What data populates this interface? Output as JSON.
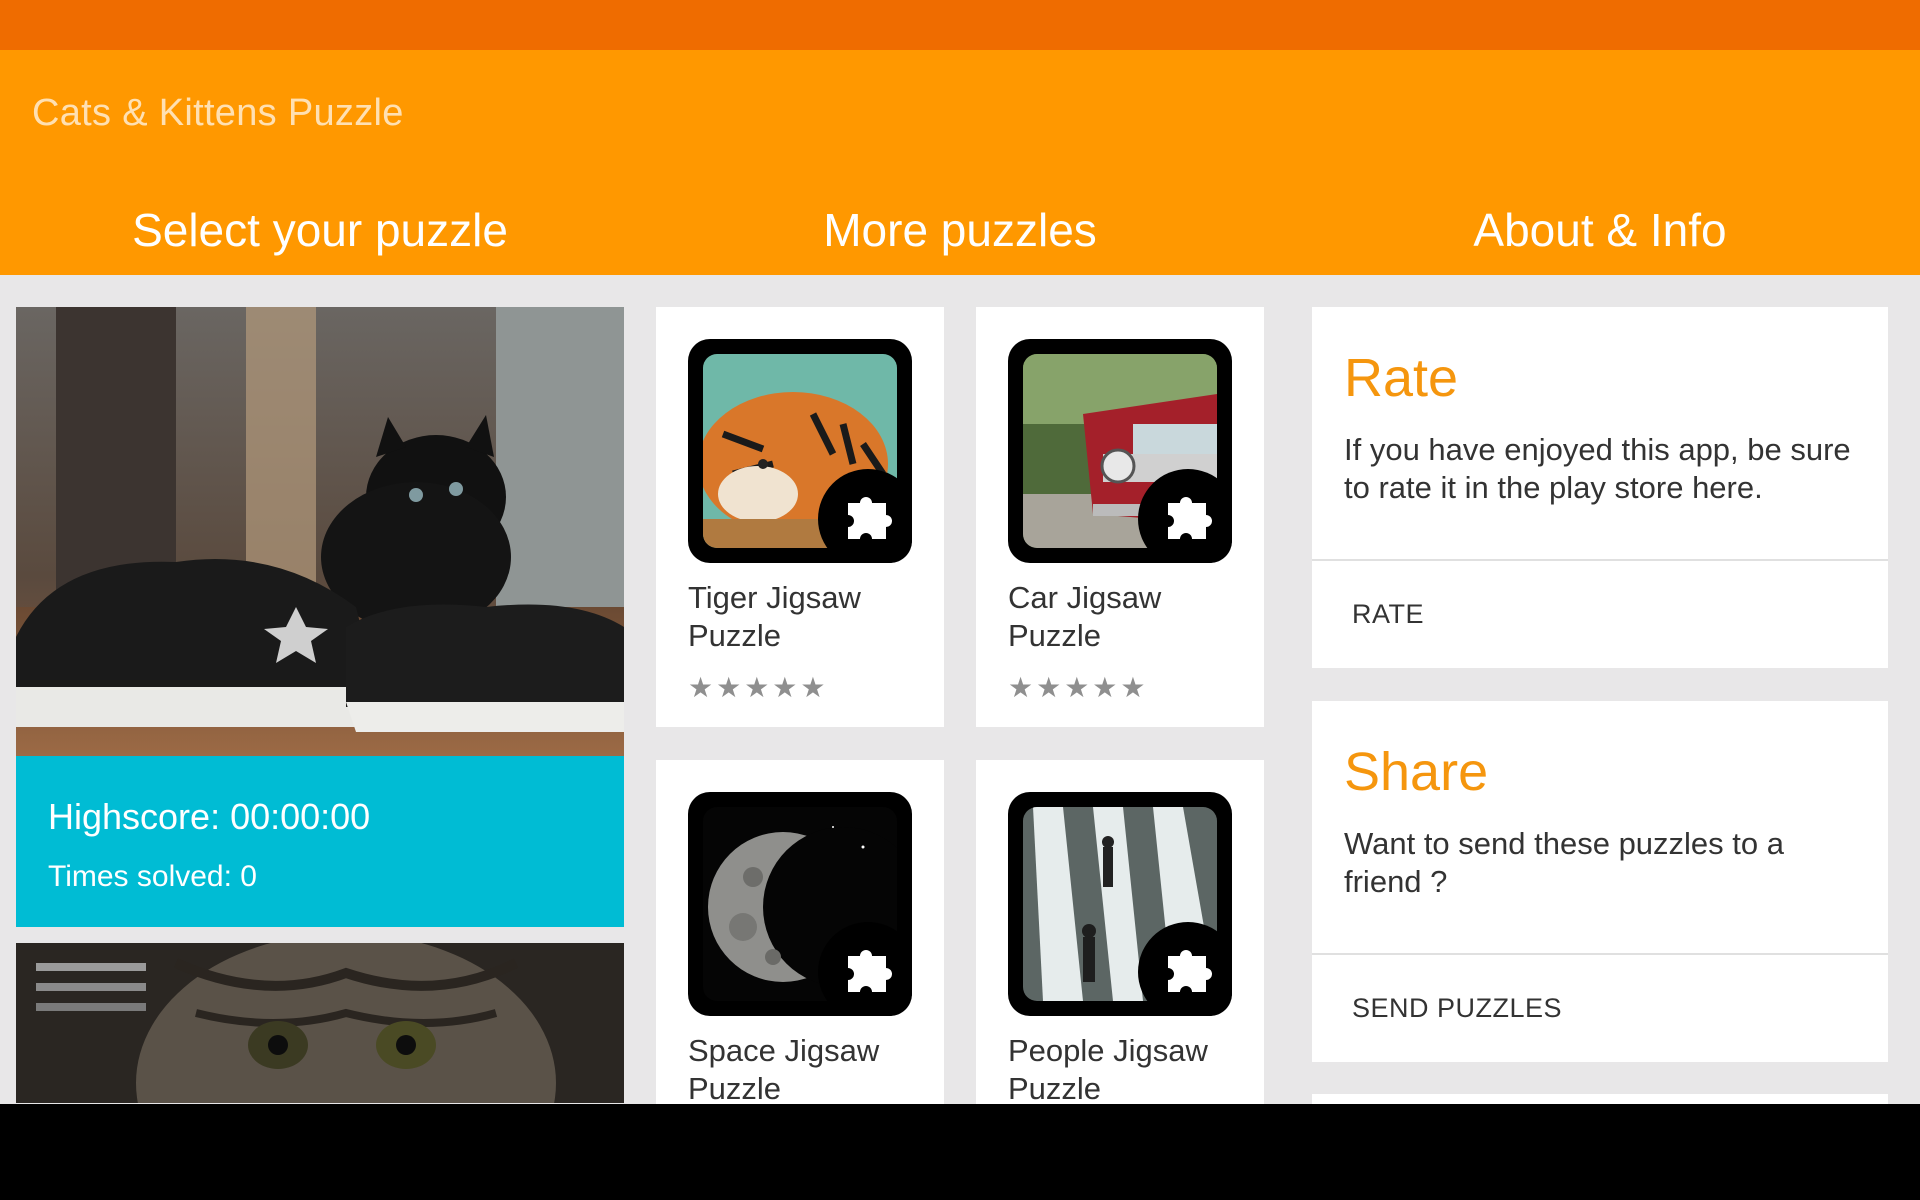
{
  "app": {
    "title": "Cats & Kittens Puzzle"
  },
  "tabs": [
    {
      "label": "Select your puzzle"
    },
    {
      "label": "More puzzles"
    },
    {
      "label": "About & Info"
    }
  ],
  "select_puzzle": {
    "cards": [
      {
        "highscore": "Highscore: 00:00:00",
        "times_solved": "Times solved: 0"
      }
    ]
  },
  "more_puzzles": {
    "items": [
      {
        "title": "Tiger Jigsaw Puzzle",
        "stars": "★★★★★"
      },
      {
        "title": "Car Jigsaw Puzzle",
        "stars": "★★★★★"
      },
      {
        "title": "Space Jigsaw Puzzle"
      },
      {
        "title": "People Jigsaw Puzzle"
      }
    ]
  },
  "about": {
    "rate": {
      "title": "Rate",
      "body": "If you have enjoyed this app, be sure to rate it in the play store here.",
      "action": "RATE"
    },
    "share": {
      "title": "Share",
      "body": "Want to send these puzzles to a friend ?",
      "action": "SEND PUZZLES"
    }
  },
  "colors": {
    "status_bar": "#ef6c00",
    "app_bar": "#ff9800",
    "title_accent": "#f5960e",
    "score_panel": "#00bcd4"
  },
  "icons": [
    "puzzle-piece-icon",
    "star-icon"
  ]
}
